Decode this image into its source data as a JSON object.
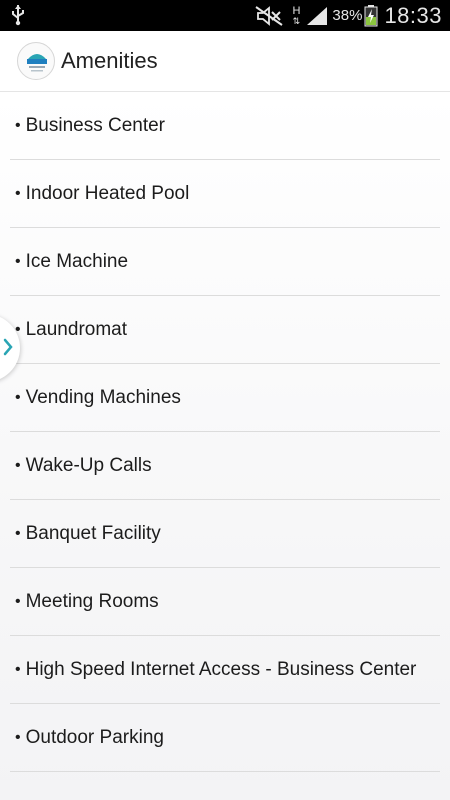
{
  "status_bar": {
    "usb_icon": "usb-icon",
    "mute_icon": "muted-icon",
    "network_label": "H",
    "signal_icon": "signal-icon",
    "battery_percent": "38%",
    "battery_icon": "battery-charging-icon",
    "time": "18:33"
  },
  "app_bar": {
    "logo_icon": "hotel-logo",
    "title": "Amenities"
  },
  "drawer_handle": {
    "icon": "chevron-right-icon"
  },
  "amenities": {
    "bullet": "•",
    "items": [
      "Business Center",
      "Indoor Heated Pool",
      "Ice Machine",
      "Laundromat",
      "Vending Machines",
      "Wake-Up Calls",
      "Banquet Facility",
      "Meeting Rooms",
      "High Speed Internet Access - Business Center",
      "Outdoor Parking"
    ]
  },
  "colors": {
    "status_bar_bg": "#000000",
    "accent": "#2aa5b4",
    "text": "#1c1c1c",
    "divider": "#dcdcdc"
  }
}
